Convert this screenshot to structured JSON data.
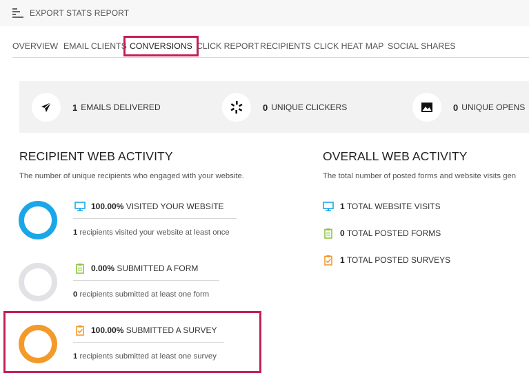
{
  "toolbar": {
    "export_label": "EXPORT STATS REPORT"
  },
  "tabs": [
    {
      "label": "OVERVIEW"
    },
    {
      "label": "EMAIL CLIENTS"
    },
    {
      "label": "CONVERSIONS",
      "active": true
    },
    {
      "label": "CLICK REPORT"
    },
    {
      "label": "RECIPIENTS"
    },
    {
      "label": "CLICK HEAT MAP"
    },
    {
      "label": "SOCIAL SHARES"
    }
  ],
  "stats": [
    {
      "value": "1",
      "label": "EMAILS DELIVERED",
      "icon": "send-icon"
    },
    {
      "value": "0",
      "label": "UNIQUE CLICKERS",
      "icon": "click-burst-icon"
    },
    {
      "value": "0",
      "label": "UNIQUE OPENS",
      "icon": "image-icon"
    }
  ],
  "recipient_activity": {
    "title": "RECIPIENT WEB ACTIVITY",
    "description": "The number of unique recipients who engaged with your website.",
    "metrics": [
      {
        "percent": "100.00%",
        "label": "VISITED YOUR WEBSITE",
        "count": "1",
        "detail": "recipients visited your website at least once",
        "fraction": 1.0,
        "color": "#1aa7e8",
        "icon": "monitor-icon"
      },
      {
        "percent": "0.00%",
        "label": "SUBMITTED A FORM",
        "count": "0",
        "detail": "recipients submitted at least one form",
        "fraction": 0.0,
        "color": "#e2e2e6",
        "icon": "clipboard-icon"
      },
      {
        "percent": "100.00%",
        "label": "SUBMITTED A SURVEY",
        "count": "1",
        "detail": "recipients submitted at least one survey",
        "fraction": 1.0,
        "color": "#f39a2b",
        "icon": "survey-check-icon"
      }
    ]
  },
  "overall_activity": {
    "title": "OVERALL WEB ACTIVITY",
    "description": "The total number of posted forms and website visits gen",
    "rows": [
      {
        "value": "1",
        "label": "TOTAL WEBSITE VISITS",
        "icon": "monitor-icon"
      },
      {
        "value": "0",
        "label": "TOTAL POSTED FORMS",
        "icon": "clipboard-icon"
      },
      {
        "value": "1",
        "label": "TOTAL POSTED SURVEYS",
        "icon": "survey-check-icon"
      }
    ]
  },
  "colors": {
    "accent_highlight": "#c41e5a",
    "blue": "#1aa7e8",
    "green": "#8cc63f",
    "orange": "#f39a2b",
    "grey_ring": "#e2e2e6"
  }
}
